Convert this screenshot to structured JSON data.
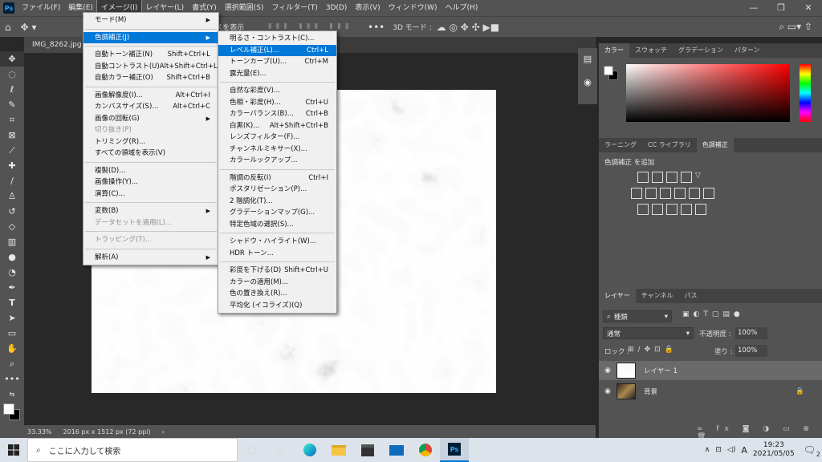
{
  "app": {
    "logo": "Ps"
  },
  "menubar": [
    "ファイル(F)",
    "編集(E)",
    "イメージ(I)",
    "レイヤー(L)",
    "書式(Y)",
    "選択範囲(S)",
    "フィルター(T)",
    "3D(D)",
    "表示(V)",
    "ウィンドウ(W)",
    "ヘルプ(H)"
  ],
  "window_controls": [
    "—",
    "❐",
    "✕"
  ],
  "optionsbar": {
    "show_transform": "ボックスを表示",
    "mode_3d": "3D モード :"
  },
  "document_tab": "IMG_8262.jpg @",
  "image_menu": [
    {
      "label": "モード(M)",
      "shortcut": "",
      "sub": true
    },
    {
      "sep": true
    },
    {
      "label": "色調補正(J)",
      "shortcut": "",
      "sub": true,
      "hl": true
    },
    {
      "sep": true
    },
    {
      "label": "自動トーン補正(N)",
      "shortcut": "Shift+Ctrl+L"
    },
    {
      "label": "自動コントラスト(U)",
      "shortcut": "Alt+Shift+Ctrl+L"
    },
    {
      "label": "自動カラー補正(O)",
      "shortcut": "Shift+Ctrl+B"
    },
    {
      "sep": true
    },
    {
      "label": "画像解像度(I)...",
      "shortcut": "Alt+Ctrl+I"
    },
    {
      "label": "カンバスサイズ(S)...",
      "shortcut": "Alt+Ctrl+C"
    },
    {
      "label": "画像の回転(G)",
      "shortcut": "",
      "sub": true
    },
    {
      "label": "切り抜き(P)",
      "shortcut": "",
      "dis": true
    },
    {
      "label": "トリミング(R)...",
      "shortcut": ""
    },
    {
      "label": "すべての領域を表示(V)",
      "shortcut": ""
    },
    {
      "sep": true
    },
    {
      "label": "複製(D)...",
      "shortcut": ""
    },
    {
      "label": "画像操作(Y)...",
      "shortcut": ""
    },
    {
      "label": "演算(C)...",
      "shortcut": ""
    },
    {
      "sep": true
    },
    {
      "label": "変数(B)",
      "shortcut": "",
      "sub": true
    },
    {
      "label": "データセットを適用(L)...",
      "shortcut": "",
      "dis": true
    },
    {
      "sep": true
    },
    {
      "label": "トラッピング(T)...",
      "shortcut": "",
      "dis": true
    },
    {
      "sep": true
    },
    {
      "label": "解析(A)",
      "shortcut": "",
      "sub": true
    }
  ],
  "adjust_menu": [
    {
      "label": "明るさ・コントラスト(C)...",
      "shortcut": ""
    },
    {
      "label": "レベル補正(L)...",
      "shortcut": "Ctrl+L",
      "hl": true
    },
    {
      "label": "トーンカーブ(U)...",
      "shortcut": "Ctrl+M"
    },
    {
      "label": "露光量(E)...",
      "shortcut": ""
    },
    {
      "sep": true
    },
    {
      "label": "自然な彩度(V)...",
      "shortcut": ""
    },
    {
      "label": "色相・彩度(H)...",
      "shortcut": "Ctrl+U"
    },
    {
      "label": "カラーバランス(B)...",
      "shortcut": "Ctrl+B"
    },
    {
      "label": "白黒(K)...",
      "shortcut": "Alt+Shift+Ctrl+B"
    },
    {
      "label": "レンズフィルター(F)...",
      "shortcut": ""
    },
    {
      "label": "チャンネルミキサー(X)...",
      "shortcut": ""
    },
    {
      "label": "カラールックアップ...",
      "shortcut": ""
    },
    {
      "sep": true
    },
    {
      "label": "階調の反転(I)",
      "shortcut": "Ctrl+I"
    },
    {
      "label": "ポスタリゼーション(P)...",
      "shortcut": ""
    },
    {
      "label": "2 階調化(T)...",
      "shortcut": ""
    },
    {
      "label": "グラデーションマップ(G)...",
      "shortcut": ""
    },
    {
      "label": "特定色域の選択(S)...",
      "shortcut": ""
    },
    {
      "sep": true
    },
    {
      "label": "シャドウ・ハイライト(W)...",
      "shortcut": ""
    },
    {
      "label": "HDR トーン...",
      "shortcut": ""
    },
    {
      "sep": true
    },
    {
      "label": "彩度を下げる(D)",
      "shortcut": "Shift+Ctrl+U"
    },
    {
      "label": "カラーの適用(M)...",
      "shortcut": ""
    },
    {
      "label": "色の置き換え(R)...",
      "shortcut": ""
    },
    {
      "label": "平均化 (イコライズ)(Q)",
      "shortcut": ""
    }
  ],
  "status": {
    "zoom": "33.33%",
    "doc_size": "2016 px x 1512 px (72 ppi)",
    "arrow": "›"
  },
  "color_panel": {
    "tabs": [
      "カラー",
      "スウォッチ",
      "グラデーション",
      "パターン"
    ]
  },
  "adjust_panel": {
    "tabs": [
      "ラーニング",
      "CC ライブラリ",
      "色調補正"
    ],
    "title": "色調補正 を追加"
  },
  "layers_panel": {
    "tabs": [
      "レイヤー",
      "チャンネル",
      "パス"
    ],
    "kind": "種類",
    "blend": "通常",
    "opacity_label": "不透明度 :",
    "opacity": "100%",
    "lock_label": "ロック :",
    "fill_label": "塗り :",
    "fill": "100%",
    "layers": [
      {
        "name": "レイヤー 1"
      },
      {
        "name": "背景"
      }
    ]
  },
  "taskbar": {
    "search_placeholder": "ここに入力して検索",
    "time": "19:23",
    "date": "2021/05/05",
    "ime": "A",
    "notif": "2"
  }
}
